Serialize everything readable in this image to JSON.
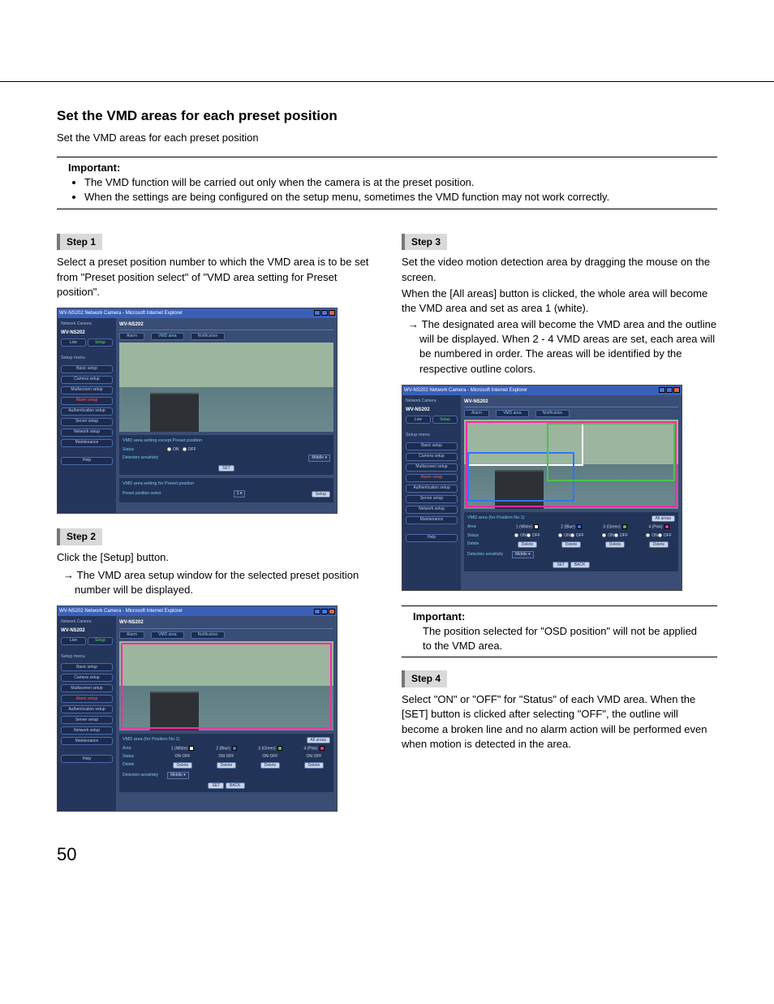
{
  "page_number": "50",
  "title": "Set the VMD areas for each preset position",
  "subtitle": "Set the VMD areas for each preset position",
  "important": {
    "label": "Important:",
    "items": [
      "The VMD function will be carried out only when the camera is at the preset position.",
      "When the settings are being configured on the setup menu, sometimes the VMD function may not work correctly."
    ]
  },
  "left": {
    "step1": {
      "badge": "Step 1",
      "text": "Select a preset position number to which the VMD area is to be set from \"Preset position select\" of \"VMD area setting for Preset position\"."
    },
    "step2": {
      "badge": "Step 2",
      "text": "Click the [Setup] button.",
      "arrow": "The VMD area setup window for the selected preset position number will be displayed."
    }
  },
  "right": {
    "step3": {
      "badge": "Step 3",
      "text1": "Set the video motion detection area by dragging the mouse on the screen.",
      "text2": "When the [All areas] button is clicked, the whole area will become the VMD area and set as area 1 (white).",
      "arrow": "The designated area will become the VMD area and the outline will be displayed. When 2 - 4 VMD areas are set, each area will be numbered in order. The areas will be identified by the respective outline colors."
    },
    "important2": {
      "label": "Important:",
      "text": "The position selected for \"OSD position\" will not be applied to the VMD area."
    },
    "step4": {
      "badge": "Step 4",
      "text": "Select \"ON\" or \"OFF\" for \"Status\" of each VMD area. When the [SET] button is clicked after selecting \"OFF\", the outline will become a broken line and no alarm action will be performed even when motion is detected in the area."
    }
  },
  "screenshot": {
    "window_title": "WV-NS202 Network Camera - Microsoft Internet Explorer",
    "device": "WV-NS202",
    "live": "Live",
    "setup": "Setup",
    "menu_label": "Setup menu",
    "menu": {
      "basic": "Basic setup",
      "camera": "Camera setup",
      "multiscreen": "Multiscreen setup",
      "alarm": "Alarm setup",
      "auth": "Authentication setup",
      "server": "Server setup",
      "network": "Network setup",
      "maintenance": "Maintenance",
      "help": "Help"
    },
    "tabs": {
      "alarm": "Alarm",
      "vmd": "VMD area",
      "notification": "Notification"
    },
    "panel1": {
      "title1": "VMD area setting except Preset position",
      "status": "Status",
      "on": "ON",
      "off": "OFF",
      "sens": "Detection sensitivity",
      "middle": "Middle",
      "set": "SET",
      "title2": "VMD area setting for Preset position",
      "preset_sel": "Preset position select",
      "setup_btn": "Setup"
    },
    "panel2": {
      "title": "VMD area (for Position No.1)",
      "all_areas": "All areas",
      "area_label": "Area",
      "status_label": "Status",
      "delete_label": "Delete",
      "sens_label": "Detection sensitivity",
      "a1": "1 (White)",
      "a2": "2 (Blue)",
      "a3": "3 (Green)",
      "a4": "4 (Pink)",
      "on": "ON",
      "off": "OFF",
      "delete": "Delete",
      "middle": "Middle",
      "set": "SET",
      "back": "BACK"
    }
  }
}
